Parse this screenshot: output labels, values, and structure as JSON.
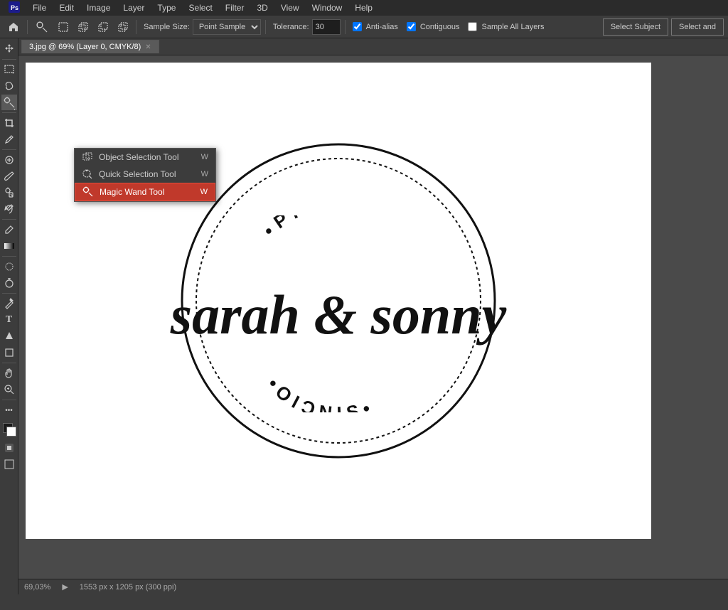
{
  "app": {
    "title": "Adobe Photoshop"
  },
  "menubar": {
    "items": [
      "PS",
      "File",
      "Edit",
      "Image",
      "Layer",
      "Type",
      "Select",
      "Filter",
      "3D",
      "View",
      "Window",
      "Help"
    ]
  },
  "toolbar": {
    "sample_size_label": "Sample Size:",
    "sample_size_value": "Point Sample",
    "tolerance_label": "Tolerance:",
    "tolerance_value": "30",
    "anti_alias_label": "Anti-alias",
    "anti_alias_checked": true,
    "contiguous_label": "Contiguous",
    "contiguous_checked": true,
    "sample_all_layers_label": "Sample All Layers",
    "sample_all_layers_checked": false,
    "select_subject_label": "Select Subject",
    "select_and_label": "Select and"
  },
  "tab": {
    "name": "3.jpg @ 69% (Layer 0, CMYK/8)",
    "modified": true
  },
  "flyout": {
    "items": [
      {
        "label": "Object Selection Tool",
        "shortcut": "W",
        "icon": "object-select"
      },
      {
        "label": "Quick Selection Tool",
        "shortcut": "W",
        "icon": "quick-select"
      },
      {
        "label": "Magic Wand Tool",
        "shortcut": "W",
        "icon": "magic-wand",
        "highlighted": true
      }
    ]
  },
  "canvas": {
    "photo_text": "•PHOTO•",
    "main_text": "sarah & sonny",
    "studio_text": "•OIƏNIS•",
    "zoom": "69%"
  },
  "statusbar": {
    "zoom": "69,03%",
    "dimensions": "1553 px x 1205 px (300 ppi)"
  },
  "tools": {
    "move": "✛",
    "marquee": "⬚",
    "lasso": "⌇",
    "magic_wand": "✦",
    "crop": "⌗",
    "eyedropper": "🔭",
    "spot_heal": "◎",
    "brush": "◉",
    "clone": "✦",
    "history_brush": "◌",
    "eraser": "◻",
    "gradient": "■",
    "blur": "▲",
    "dodge": "○",
    "pen": "✒",
    "text": "T",
    "path_select": "⬡",
    "shape": "□",
    "hand": "✋",
    "zoom_tool": "🔍",
    "foreground": "■",
    "background": "□"
  }
}
